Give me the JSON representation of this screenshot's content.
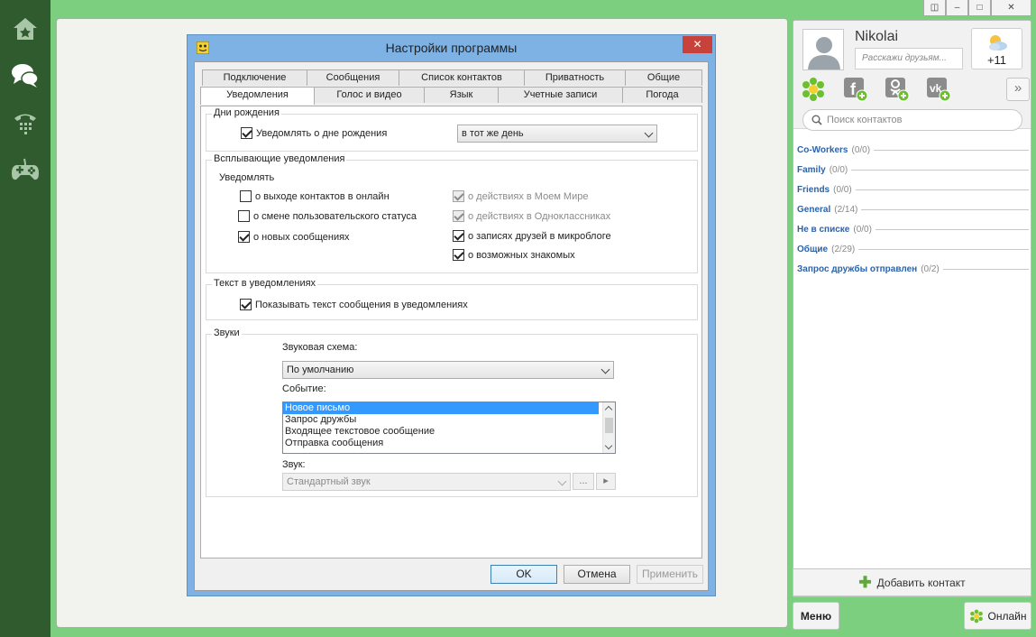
{
  "window_controls": {
    "restore": "◫",
    "minimize": "–",
    "maximize": "□",
    "close": "✕"
  },
  "profile": {
    "name": "Nikolai",
    "status_placeholder": "Расскажи друзьям...",
    "weather_temp": "+11",
    "expand_glyph": "»"
  },
  "search": {
    "placeholder": "Поиск контактов"
  },
  "groups": [
    {
      "name": "Co-Workers",
      "count": "(0/0)"
    },
    {
      "name": "Family",
      "count": "(0/0)"
    },
    {
      "name": "Friends",
      "count": "(0/0)"
    },
    {
      "name": "General",
      "count": "(2/14)"
    },
    {
      "name": "Не в списке",
      "count": "(0/0)"
    },
    {
      "name": "Общие",
      "count": "(2/29)"
    },
    {
      "name": "Запрос дружбы отправлен",
      "count": "(0/2)"
    }
  ],
  "bottom": {
    "add_contact": "Добавить контакт",
    "menu": "Меню",
    "online": "Онлайн"
  },
  "dialog": {
    "title": "Настройки программы",
    "close": "✕",
    "tabs_top": [
      "Подключение",
      "Сообщения",
      "Список контактов",
      "Приватность",
      "Общие"
    ],
    "tabs_bottom": [
      "Уведомления",
      "Голос и видео",
      "Язык",
      "Учетные записи",
      "Погода"
    ],
    "birthdays": {
      "legend": "Дни рождения",
      "notify": "Уведомлять о дне рождения",
      "when": "в тот же день"
    },
    "popups": {
      "legend": "Всплывающие уведомления",
      "sublabel": "Уведомлять",
      "online": "о выходе контактов в онлайн",
      "status_change": "о смене пользовательского статуса",
      "new_messages": "о новых сообщениях",
      "my_world": "о действиях в Моем Мире",
      "odnoklassniki": "о действиях в Одноклассниках",
      "microblog": "о записях друзей в микроблоге",
      "acquaintances": "о возможных знакомых"
    },
    "text": {
      "legend": "Текст в уведомлениях",
      "show": "Показывать текст сообщения в уведомлениях"
    },
    "sounds": {
      "legend": "Звуки",
      "scheme_label": "Звуковая схема:",
      "scheme_value": "По умолчанию",
      "event_label": "Событие:",
      "events": [
        "Новое письмо",
        "Запрос дружбы",
        "Входящее текстовое сообщение",
        "Отправка сообщения"
      ],
      "sound_label": "Звук:",
      "sound_value": "Стандартный звук",
      "browse": "...",
      "play": "▸"
    },
    "buttons": {
      "ok": "OK",
      "cancel": "Отмена",
      "apply": "Применить"
    }
  }
}
